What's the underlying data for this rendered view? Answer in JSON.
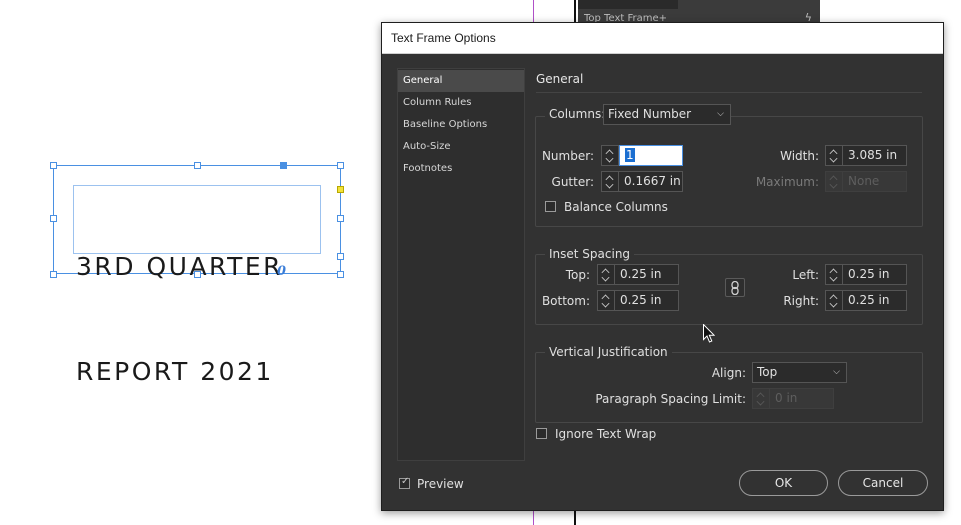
{
  "background_panel": {
    "label": "Top Text Frame+",
    "icon": "lightning-icon"
  },
  "document": {
    "frame_text_line1": "3RD QUARTER",
    "frame_text_line2": "REPORT 2021",
    "overset_symbol": "0"
  },
  "dialog": {
    "title": "Text Frame Options",
    "nav": [
      {
        "label": "General",
        "active": true
      },
      {
        "label": "Column Rules",
        "active": false
      },
      {
        "label": "Baseline Options",
        "active": false
      },
      {
        "label": "Auto-Size",
        "active": false
      },
      {
        "label": "Footnotes",
        "active": false
      }
    ],
    "section_title": "General",
    "columns": {
      "label": "Columns:",
      "type_value": "Fixed Number",
      "number_label": "Number:",
      "number_value": "1",
      "gutter_label": "Gutter:",
      "gutter_value": "0.1667 in",
      "width_label": "Width:",
      "width_value": "3.085 in",
      "maximum_label": "Maximum:",
      "maximum_value": "None",
      "balance_label": "Balance Columns",
      "balance_checked": false
    },
    "inset": {
      "legend": "Inset Spacing",
      "top_label": "Top:",
      "top_value": "0.25 in",
      "bottom_label": "Bottom:",
      "bottom_value": "0.25 in",
      "left_label": "Left:",
      "left_value": "0.25 in",
      "right_label": "Right:",
      "right_value": "0.25 in",
      "link_icon": "chain-link-icon"
    },
    "vertical": {
      "legend": "Vertical Justification",
      "align_label": "Align:",
      "align_value": "Top",
      "para_spacing_label": "Paragraph Spacing Limit:",
      "para_spacing_value": "0 in"
    },
    "ignore_wrap_label": "Ignore Text Wrap",
    "ignore_wrap_checked": false,
    "preview_label": "Preview",
    "preview_checked": true,
    "ok_label": "OK",
    "cancel_label": "Cancel"
  },
  "colors": {
    "dialog_bg": "#323232",
    "selection_blue": "#4a90e2",
    "guide_magenta": "#b050c8"
  }
}
